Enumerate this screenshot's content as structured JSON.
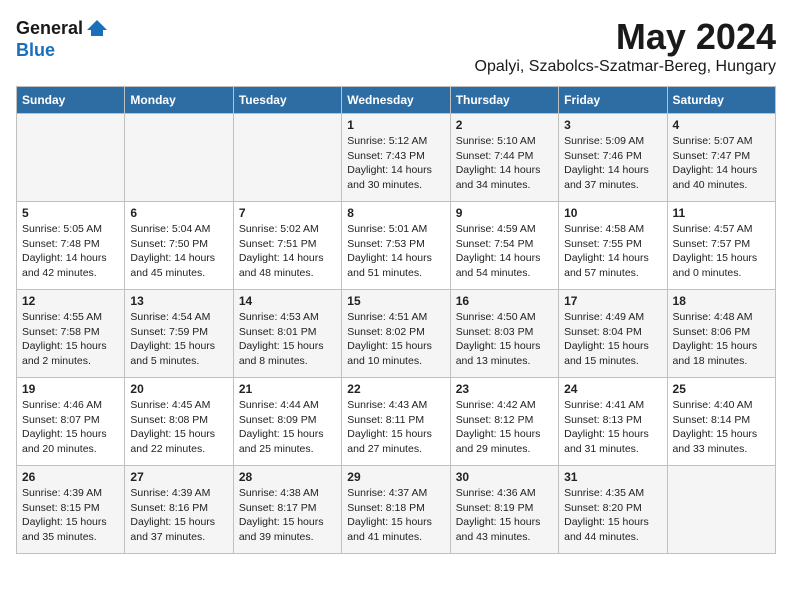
{
  "header": {
    "logo_general": "General",
    "logo_blue": "Blue",
    "month": "May 2024",
    "location": "Opalyi, Szabolcs-Szatmar-Bereg, Hungary"
  },
  "columns": [
    "Sunday",
    "Monday",
    "Tuesday",
    "Wednesday",
    "Thursday",
    "Friday",
    "Saturday"
  ],
  "weeks": [
    {
      "days": [
        {
          "num": "",
          "info": ""
        },
        {
          "num": "",
          "info": ""
        },
        {
          "num": "",
          "info": ""
        },
        {
          "num": "1",
          "info": "Sunrise: 5:12 AM\nSunset: 7:43 PM\nDaylight: 14 hours\nand 30 minutes."
        },
        {
          "num": "2",
          "info": "Sunrise: 5:10 AM\nSunset: 7:44 PM\nDaylight: 14 hours\nand 34 minutes."
        },
        {
          "num": "3",
          "info": "Sunrise: 5:09 AM\nSunset: 7:46 PM\nDaylight: 14 hours\nand 37 minutes."
        },
        {
          "num": "4",
          "info": "Sunrise: 5:07 AM\nSunset: 7:47 PM\nDaylight: 14 hours\nand 40 minutes."
        }
      ]
    },
    {
      "days": [
        {
          "num": "5",
          "info": "Sunrise: 5:05 AM\nSunset: 7:48 PM\nDaylight: 14 hours\nand 42 minutes."
        },
        {
          "num": "6",
          "info": "Sunrise: 5:04 AM\nSunset: 7:50 PM\nDaylight: 14 hours\nand 45 minutes."
        },
        {
          "num": "7",
          "info": "Sunrise: 5:02 AM\nSunset: 7:51 PM\nDaylight: 14 hours\nand 48 minutes."
        },
        {
          "num": "8",
          "info": "Sunrise: 5:01 AM\nSunset: 7:53 PM\nDaylight: 14 hours\nand 51 minutes."
        },
        {
          "num": "9",
          "info": "Sunrise: 4:59 AM\nSunset: 7:54 PM\nDaylight: 14 hours\nand 54 minutes."
        },
        {
          "num": "10",
          "info": "Sunrise: 4:58 AM\nSunset: 7:55 PM\nDaylight: 14 hours\nand 57 minutes."
        },
        {
          "num": "11",
          "info": "Sunrise: 4:57 AM\nSunset: 7:57 PM\nDaylight: 15 hours\nand 0 minutes."
        }
      ]
    },
    {
      "days": [
        {
          "num": "12",
          "info": "Sunrise: 4:55 AM\nSunset: 7:58 PM\nDaylight: 15 hours\nand 2 minutes."
        },
        {
          "num": "13",
          "info": "Sunrise: 4:54 AM\nSunset: 7:59 PM\nDaylight: 15 hours\nand 5 minutes."
        },
        {
          "num": "14",
          "info": "Sunrise: 4:53 AM\nSunset: 8:01 PM\nDaylight: 15 hours\nand 8 minutes."
        },
        {
          "num": "15",
          "info": "Sunrise: 4:51 AM\nSunset: 8:02 PM\nDaylight: 15 hours\nand 10 minutes."
        },
        {
          "num": "16",
          "info": "Sunrise: 4:50 AM\nSunset: 8:03 PM\nDaylight: 15 hours\nand 13 minutes."
        },
        {
          "num": "17",
          "info": "Sunrise: 4:49 AM\nSunset: 8:04 PM\nDaylight: 15 hours\nand 15 minutes."
        },
        {
          "num": "18",
          "info": "Sunrise: 4:48 AM\nSunset: 8:06 PM\nDaylight: 15 hours\nand 18 minutes."
        }
      ]
    },
    {
      "days": [
        {
          "num": "19",
          "info": "Sunrise: 4:46 AM\nSunset: 8:07 PM\nDaylight: 15 hours\nand 20 minutes."
        },
        {
          "num": "20",
          "info": "Sunrise: 4:45 AM\nSunset: 8:08 PM\nDaylight: 15 hours\nand 22 minutes."
        },
        {
          "num": "21",
          "info": "Sunrise: 4:44 AM\nSunset: 8:09 PM\nDaylight: 15 hours\nand 25 minutes."
        },
        {
          "num": "22",
          "info": "Sunrise: 4:43 AM\nSunset: 8:11 PM\nDaylight: 15 hours\nand 27 minutes."
        },
        {
          "num": "23",
          "info": "Sunrise: 4:42 AM\nSunset: 8:12 PM\nDaylight: 15 hours\nand 29 minutes."
        },
        {
          "num": "24",
          "info": "Sunrise: 4:41 AM\nSunset: 8:13 PM\nDaylight: 15 hours\nand 31 minutes."
        },
        {
          "num": "25",
          "info": "Sunrise: 4:40 AM\nSunset: 8:14 PM\nDaylight: 15 hours\nand 33 minutes."
        }
      ]
    },
    {
      "days": [
        {
          "num": "26",
          "info": "Sunrise: 4:39 AM\nSunset: 8:15 PM\nDaylight: 15 hours\nand 35 minutes."
        },
        {
          "num": "27",
          "info": "Sunrise: 4:39 AM\nSunset: 8:16 PM\nDaylight: 15 hours\nand 37 minutes."
        },
        {
          "num": "28",
          "info": "Sunrise: 4:38 AM\nSunset: 8:17 PM\nDaylight: 15 hours\nand 39 minutes."
        },
        {
          "num": "29",
          "info": "Sunrise: 4:37 AM\nSunset: 8:18 PM\nDaylight: 15 hours\nand 41 minutes."
        },
        {
          "num": "30",
          "info": "Sunrise: 4:36 AM\nSunset: 8:19 PM\nDaylight: 15 hours\nand 43 minutes."
        },
        {
          "num": "31",
          "info": "Sunrise: 4:35 AM\nSunset: 8:20 PM\nDaylight: 15 hours\nand 44 minutes."
        },
        {
          "num": "",
          "info": ""
        }
      ]
    }
  ]
}
